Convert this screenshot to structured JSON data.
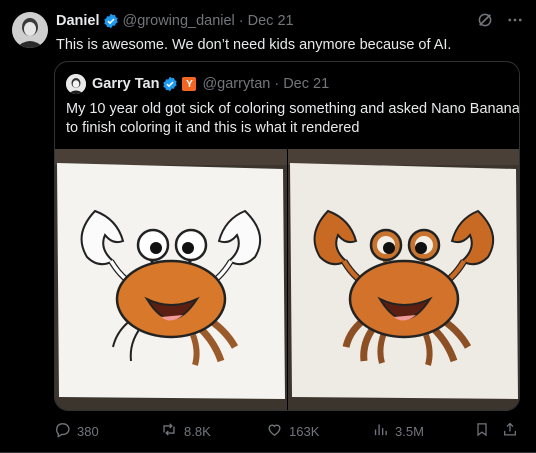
{
  "tweet": {
    "author_name": "Daniel",
    "author_handle": "@growing_daniel",
    "separator": "·",
    "date": "Dec 21",
    "text": "This is awesome. We don’t need kids anymore because of AI.",
    "colors": {
      "verified": "#1d9bf0",
      "muted": "#71767b",
      "text": "#e7e9ea",
      "border": "#2f3336"
    }
  },
  "quote": {
    "author_name": "Garry Tan",
    "badge_letter": "Y",
    "author_handle": "@garrytan",
    "separator": "·",
    "date": "Dec 21",
    "text_line1": "My 10 year old got sick of coloring something and asked Nano Banana",
    "text_line2": "to finish coloring it and this is what it rendered",
    "images": [
      "partially-colored-crab-drawing",
      "fully-colored-crab-drawing"
    ]
  },
  "actions": {
    "replies": "380",
    "reposts": "8.8K",
    "likes": "163K",
    "views": "3.5M"
  }
}
